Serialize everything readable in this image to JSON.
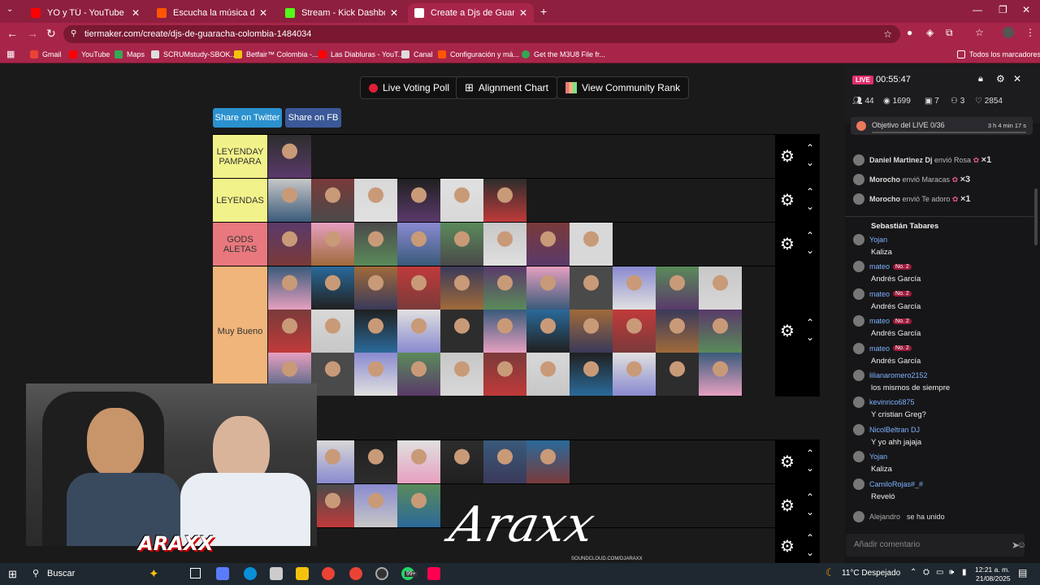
{
  "browser": {
    "tabs": [
      {
        "title": "YO y TÚ - YouTube",
        "color": "#ff0000"
      },
      {
        "title": "Escucha la música de Araxx",
        "color": "#ff5500"
      },
      {
        "title": "Stream - Kick Dashboard",
        "color": "#53fc18"
      },
      {
        "title": "Create a Djs de Guaracha COLO",
        "color": "#3b5998"
      }
    ],
    "url": "tiermaker.com/create/djs-de-guaracha-colombia-1484034",
    "bookmarks": [
      "Gmail",
      "YouTube",
      "Maps",
      "SCRUMstudy-SBOK...",
      "Betfair™ Colombia -...",
      "Las Diabluras - YouT...",
      "Canal",
      "Configuración y má...",
      "Get the M3U8 File fr...",
      "Todos los marcadores"
    ]
  },
  "page": {
    "buttons": {
      "live_voting": "Live Voting Poll",
      "alignment": "Alignment Chart",
      "community": "View Community Rank"
    },
    "share": {
      "twitter": "Share on Twitter",
      "fb": "Share on FB"
    },
    "tiers": [
      {
        "label": "LEYENDAY PAMPARA",
        "color": "#f2f28a",
        "count": 1
      },
      {
        "label": "LEYENDAS",
        "color": "#f2f28a",
        "count": 6
      },
      {
        "label": "GODS ALETAS",
        "color": "#e8787e",
        "count": 8
      },
      {
        "label": "Muy Bueno",
        "color": "#f0b57a",
        "count": 33
      },
      {
        "label": "",
        "color": "#1a1a1a",
        "count": 7
      },
      {
        "label": "",
        "color": "#1a1a1a",
        "count": 4
      },
      {
        "label": "",
        "color": "#1a1a1a",
        "count": 0
      }
    ],
    "watermark": "Araxx",
    "watermark_sub": "SOUNDCLOUD.COM/DJARAXX"
  },
  "chat": {
    "live_badge": "LIVE",
    "timer": "00:55:47",
    "stats": [
      "44",
      "1699",
      "7",
      "3",
      "2854"
    ],
    "goal": "Objetivo del LIVE",
    "goal_progress": "0/36",
    "goal_time": "3 h 4 min 17 s",
    "gifts": [
      {
        "user": "Daniel Martinez Dj",
        "action": "envió Rosa",
        "count": "×1"
      },
      {
        "user": "Morocho",
        "action": "envió Maracas",
        "count": "×3"
      },
      {
        "user": "Morocho",
        "action": "envió Te adoro",
        "count": "×1"
      }
    ],
    "messages": [
      {
        "user": "",
        "text": "Sebastián Tabares",
        "badge": ""
      },
      {
        "user": "Yojan",
        "text": "Kaliza",
        "badge": ""
      },
      {
        "user": "mateo",
        "text": "Andrés García",
        "badge": "No. 2"
      },
      {
        "user": "mateo",
        "text": "Andrés García",
        "badge": "No. 2"
      },
      {
        "user": "mateo",
        "text": "Andrés García",
        "badge": "No. 2"
      },
      {
        "user": "mateo",
        "text": "Andrés García",
        "badge": "No. 2"
      },
      {
        "user": "lilianaromero2152",
        "text": "los mismos de siempre",
        "badge": ""
      },
      {
        "user": "kevinrico6875",
        "text": "Y cristian Greg?",
        "badge": ""
      },
      {
        "user": "NicolBeltran DJ",
        "text": "Y yo ahh jajaja",
        "badge": ""
      },
      {
        "user": "Yojan",
        "text": "Kaliza",
        "badge": ""
      },
      {
        "user": "CamiloRojas#_#",
        "text": "Reveló",
        "badge": ""
      }
    ],
    "joined_user": "Alejandro",
    "joined_text": "se ha unido",
    "comment_placeholder": "Añadir comentario"
  },
  "taskbar": {
    "search": "Buscar",
    "weather": "11°C  Despejado",
    "time": "12:21 a. m.",
    "date": "21/08/2025",
    "badge": "99+"
  }
}
